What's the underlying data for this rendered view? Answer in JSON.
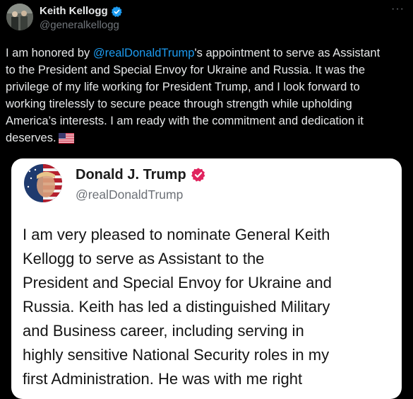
{
  "author": {
    "name": "Keith Kellogg",
    "handle": "@generalkellogg",
    "verified_color": "#1d9bf0"
  },
  "tweet": {
    "lines": [
      {
        "mention": "",
        "text": "I am honored by ",
        "mention2": "@realDonaldTrump",
        "rest": "'s appointment to serve as Assistant"
      },
      "to the President and Special Envoy for Ukraine and Russia. It was the",
      "privilege of my life working for President Trump, and I look forward to",
      "working tirelessly to secure peace through strength while upholding",
      "America’s interests. I am ready with the commitment and dedication it",
      "deserves."
    ],
    "emoji": "us-flag-icon",
    "mention_color": "#1d9bf0"
  },
  "quoted": {
    "name": "Donald J. Trump",
    "handle": "@realDonaldTrump",
    "verified_color": "#e0245e",
    "lines": [
      "I am very pleased to nominate General Keith",
      "Kellogg to serve as Assistant to the",
      "President and Special Envoy for Ukraine and",
      "Russia. Keith has led a distinguished Military",
      "and Business career, including serving in",
      "highly sensitive National Security roles in my",
      "first Administration. He was with me right"
    ]
  },
  "more_label": "···"
}
